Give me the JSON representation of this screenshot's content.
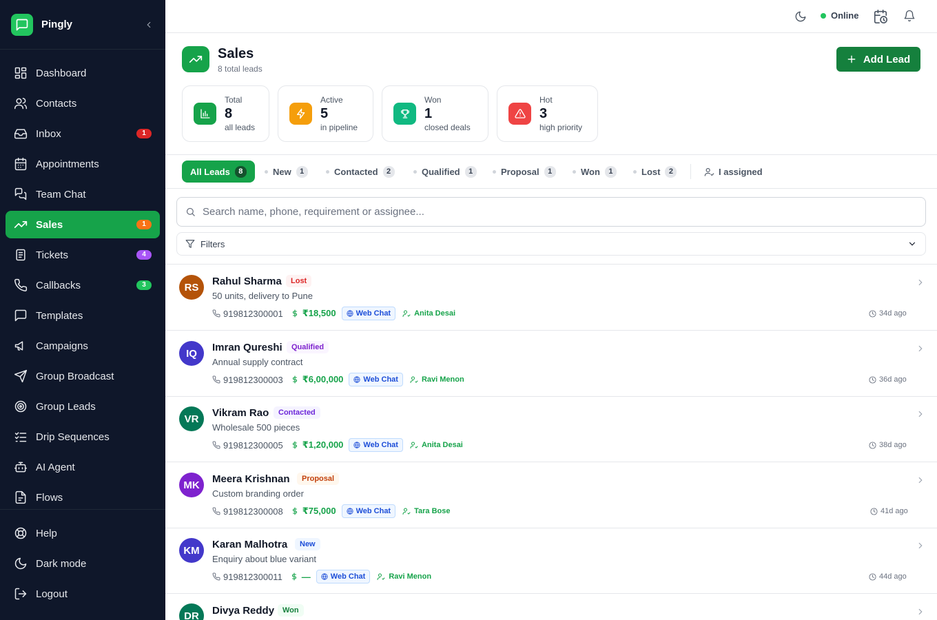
{
  "app": {
    "name": "Pingly"
  },
  "nav": {
    "items": [
      {
        "label": "Dashboard",
        "icon": "dashboard-icon"
      },
      {
        "label": "Contacts",
        "icon": "contacts-icon"
      },
      {
        "label": "Inbox",
        "icon": "inbox-icon",
        "badge": "1",
        "badge_color": "#dc2626"
      },
      {
        "label": "Appointments",
        "icon": "calendar-icon"
      },
      {
        "label": "Team Chat",
        "icon": "team-chat-icon"
      },
      {
        "label": "Sales",
        "icon": "trending-up-icon",
        "badge": "1",
        "badge_color": "#f97316",
        "active": true
      },
      {
        "label": "Tickets",
        "icon": "ticket-icon",
        "badge": "4",
        "badge_color": "#a855f7"
      },
      {
        "label": "Callbacks",
        "icon": "phone-icon",
        "badge": "3",
        "badge_color": "#22c55e"
      },
      {
        "label": "Templates",
        "icon": "template-icon"
      },
      {
        "label": "Campaigns",
        "icon": "megaphone-icon"
      },
      {
        "label": "Group Broadcast",
        "icon": "send-icon"
      },
      {
        "label": "Group Leads",
        "icon": "target-icon"
      },
      {
        "label": "Drip Sequences",
        "icon": "list-check-icon"
      },
      {
        "label": "AI Agent",
        "icon": "bot-icon"
      },
      {
        "label": "Flows",
        "icon": "flow-icon"
      }
    ],
    "bottom": [
      {
        "label": "Help",
        "icon": "help-icon"
      },
      {
        "label": "Dark mode",
        "icon": "moon-icon"
      },
      {
        "label": "Logout",
        "icon": "logout-icon"
      }
    ]
  },
  "topbar": {
    "status": "Online"
  },
  "header": {
    "title": "Sales",
    "subtitle": "8 total leads",
    "add_button": "Add Lead"
  },
  "stats": [
    {
      "label": "Total",
      "value": "8",
      "sub": "all leads",
      "color": "#16a34a",
      "icon": "bar-chart-icon"
    },
    {
      "label": "Active",
      "value": "5",
      "sub": "in pipeline",
      "color": "#f59e0b",
      "icon": "zap-icon"
    },
    {
      "label": "Won",
      "value": "1",
      "sub": "closed deals",
      "color": "#10b981",
      "icon": "trophy-icon"
    },
    {
      "label": "Hot",
      "value": "3",
      "sub": "high priority",
      "color": "#ef4444",
      "icon": "alert-triangle-icon"
    }
  ],
  "tabs": [
    {
      "label": "All Leads",
      "count": "8",
      "active": true
    },
    {
      "label": "New",
      "count": "1"
    },
    {
      "label": "Contacted",
      "count": "2"
    },
    {
      "label": "Qualified",
      "count": "1"
    },
    {
      "label": "Proposal",
      "count": "1"
    },
    {
      "label": "Won",
      "count": "1"
    },
    {
      "label": "Lost",
      "count": "2"
    }
  ],
  "assigned_tab": "I assigned",
  "search": {
    "placeholder": "Search name, phone, requirement or assignee..."
  },
  "filters": {
    "label": "Filters"
  },
  "leads": [
    {
      "initials": "RS",
      "name": "Rahul Sharma",
      "status": "Lost",
      "status_fg": "#dc2626",
      "status_bg": "#fef2f2",
      "avatar_color": "#b45309",
      "requirement": "50 units, delivery to Pune",
      "phone": "919812300001",
      "value": "₹18,500",
      "source": "Web Chat",
      "assignee": "Anita Desai",
      "ago": "34d ago"
    },
    {
      "initials": "IQ",
      "name": "Imran Qureshi",
      "status": "Qualified",
      "status_fg": "#7e22ce",
      "status_bg": "#faf5ff",
      "avatar_color": "#4338ca",
      "requirement": "Annual supply contract",
      "phone": "919812300003",
      "value": "₹6,00,000",
      "source": "Web Chat",
      "assignee": "Ravi Menon",
      "ago": "36d ago"
    },
    {
      "initials": "VR",
      "name": "Vikram Rao",
      "status": "Contacted",
      "status_fg": "#6d28d9",
      "status_bg": "#f5f3ff",
      "avatar_color": "#047857",
      "requirement": "Wholesale 500 pieces",
      "phone": "919812300005",
      "value": "₹1,20,000",
      "source": "Web Chat",
      "assignee": "Anita Desai",
      "ago": "38d ago"
    },
    {
      "initials": "MK",
      "name": "Meera Krishnan",
      "status": "Proposal",
      "status_fg": "#c2410c",
      "status_bg": "#fff7ed",
      "avatar_color": "#7e22ce",
      "requirement": "Custom branding order",
      "phone": "919812300008",
      "value": "₹75,000",
      "source": "Web Chat",
      "assignee": "Tara Bose",
      "ago": "41d ago"
    },
    {
      "initials": "KM",
      "name": "Karan Malhotra",
      "status": "New",
      "status_fg": "#1d4ed8",
      "status_bg": "#eff6ff",
      "avatar_color": "#4338ca",
      "requirement": "Enquiry about blue variant",
      "phone": "919812300011",
      "value": "—",
      "source": "Web Chat",
      "assignee": "Ravi Menon",
      "ago": "44d ago"
    },
    {
      "initials": "DR",
      "name": "Divya Reddy",
      "status": "Won",
      "status_fg": "#15803d",
      "status_bg": "#f0fdf4",
      "avatar_color": "#047857",
      "requirement": "",
      "phone": "",
      "value": "",
      "source": "",
      "assignee": "",
      "ago": ""
    }
  ]
}
